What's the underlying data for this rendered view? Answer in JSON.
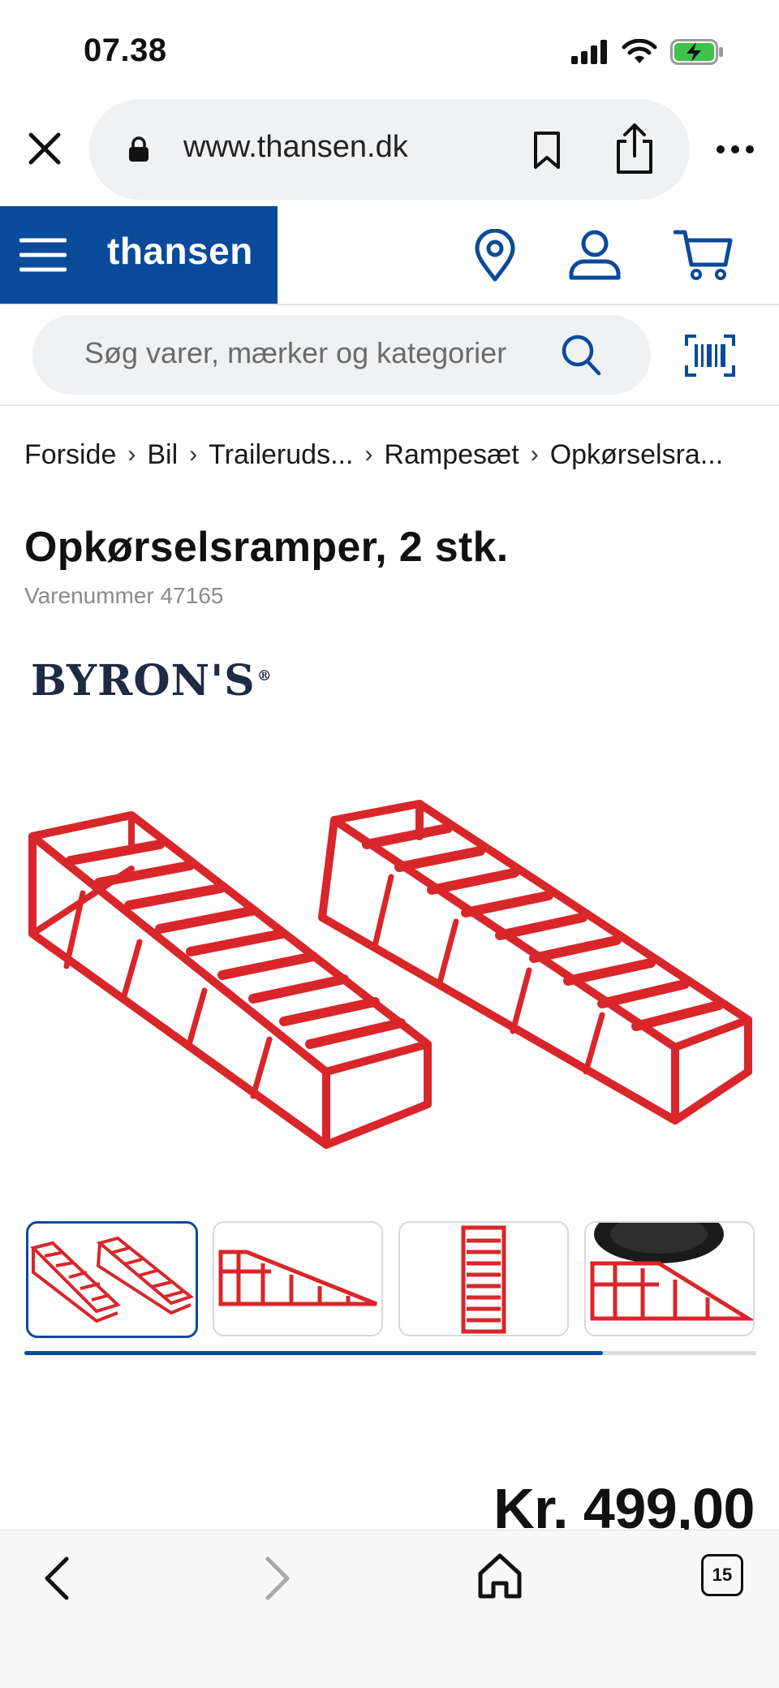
{
  "status_bar": {
    "time": "07.38"
  },
  "browser": {
    "url": "www.thansen.dk",
    "tabs_count": "15"
  },
  "site": {
    "brand": "thansen",
    "brand_color": "#0a4a9a",
    "search_placeholder": "Søg varer, mærker og kategorier"
  },
  "breadcrumb": [
    "Forside",
    "Bil",
    "Traileruds...",
    "Rampesæt",
    "Opkørselsra..."
  ],
  "breadcrumb_separator": "›",
  "product": {
    "title": "Opkørselsramper, 2 stk.",
    "sku_label": "Varenummer",
    "sku_number": "47165",
    "brand_logo": "BYRON'S",
    "brand_logo_mark": "®",
    "price": "Kr. 499,00",
    "image_color": "#d8262a",
    "gallery_progress": 0.79
  },
  "icons": {
    "close": "close-icon",
    "lock": "lock-icon",
    "bookmark": "bookmark-icon",
    "share": "share-icon",
    "more": "more-icon",
    "menu": "hamburger-icon",
    "location": "location-pin-icon",
    "account": "user-icon",
    "cart": "cart-icon",
    "search": "search-icon",
    "barcode": "barcode-scanner-icon",
    "back": "chevron-left-icon",
    "forward": "chevron-right-icon",
    "home": "home-icon"
  }
}
